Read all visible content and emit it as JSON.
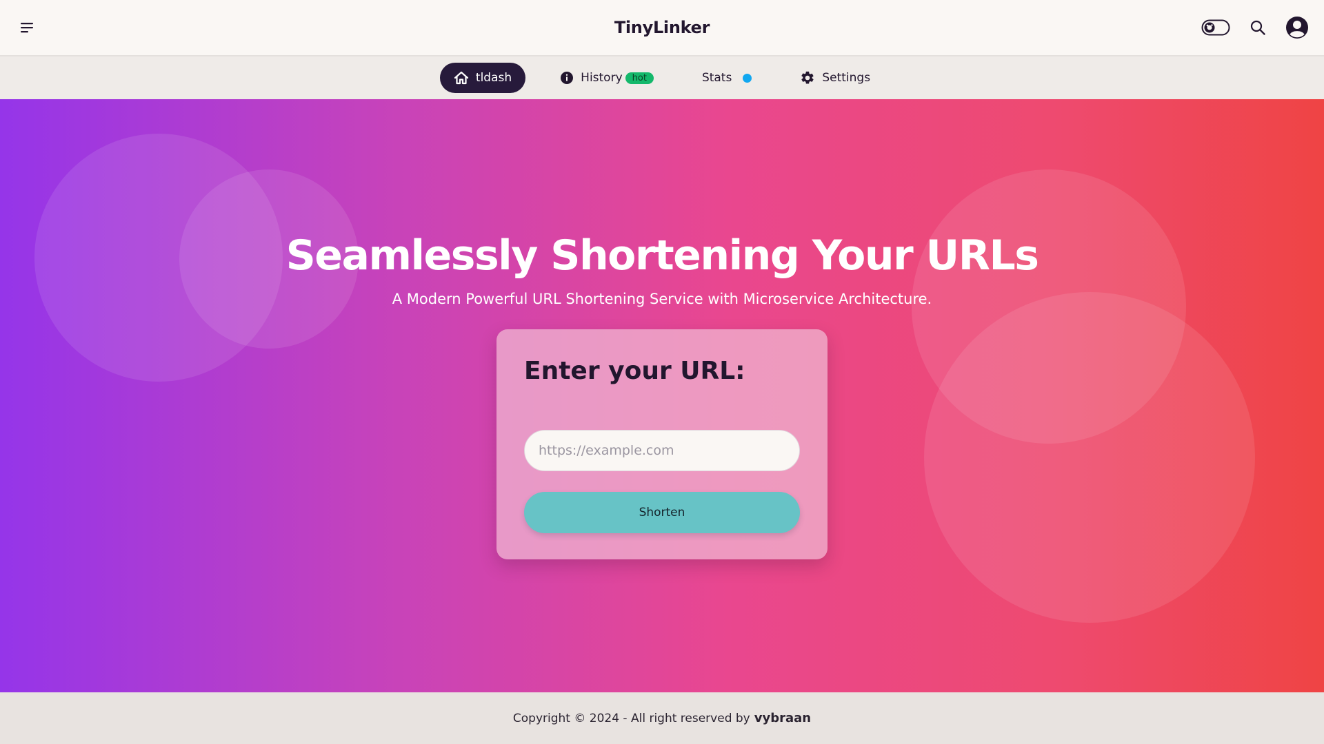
{
  "header": {
    "title": "TinyLinker",
    "menu_icon": "menu-icon",
    "theme_toggle_icon": "theme-toggle-icon",
    "search_icon": "search-icon",
    "account_icon": "user-account-icon"
  },
  "nav": {
    "items": [
      {
        "label": "tldash",
        "icon": "home-icon",
        "active": true
      },
      {
        "label": "History",
        "icon": "info-icon",
        "badge": "hot"
      },
      {
        "label": "Stats",
        "indicator": "blue-dot"
      },
      {
        "label": "Settings",
        "icon": "gear-icon"
      }
    ]
  },
  "hero": {
    "title": "Seamlessly Shortening Your URLs",
    "subtitle": "A Modern Powerful URL Shortening Service with Microservice Architecture.",
    "gradient_colors": [
      "#9535e9",
      "#e9478f",
      "#ef4444"
    ]
  },
  "form": {
    "heading": "Enter your URL:",
    "input_placeholder": "https://example.com",
    "input_value": "",
    "button_label": "Shorten",
    "button_color": "#67c3c6"
  },
  "footer": {
    "text": "Copyright © 2024 - All right reserved by",
    "author": "vybraan"
  }
}
